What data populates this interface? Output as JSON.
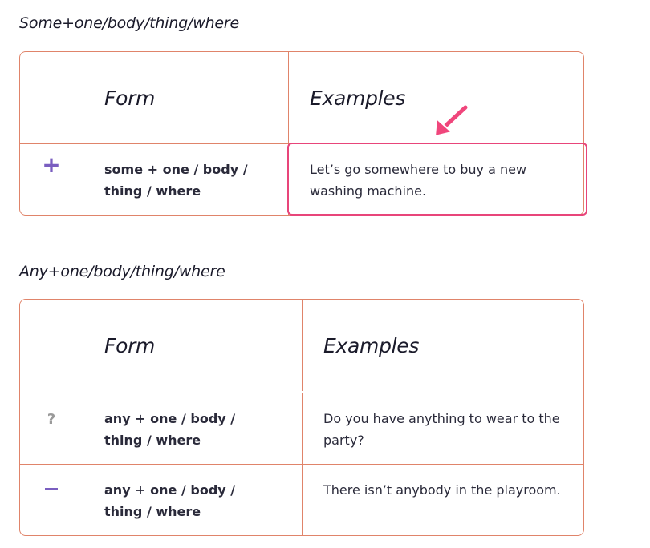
{
  "sections": [
    {
      "title": "Some+one/body/thing/where",
      "headers": {
        "symbol": "",
        "form": "Form",
        "examples": "Examples"
      },
      "rows": [
        {
          "symbol": "+",
          "symbol_icon": "plus-icon",
          "form": "some + one / body / thing / where",
          "example": "Let’s go somewhere to buy a new washing machine."
        }
      ]
    },
    {
      "title": "Any+one/body/thing/where",
      "headers": {
        "symbol": "",
        "form": "Form",
        "examples": "Examples"
      },
      "rows": [
        {
          "symbol": "?",
          "symbol_icon": "question-icon",
          "form": "any + one / body / thing / where",
          "example": "Do you have anything to wear to the party?"
        },
        {
          "symbol": "",
          "symbol_icon": "minus-icon",
          "form": "any + one / body / thing / where",
          "example": "There isn’t anybody in the playroom."
        }
      ]
    }
  ],
  "highlight": {
    "target": "sections.0.rows.0.example",
    "color": "#e8457a",
    "arrow_icon": "arrow-down-left-icon"
  },
  "colors": {
    "table_border": "#e0846a",
    "symbol_accent": "#7a5ec0",
    "symbol_muted": "#9a9a9a"
  }
}
